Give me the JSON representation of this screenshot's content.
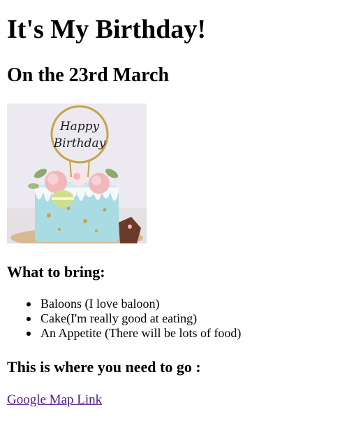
{
  "title": "It's My Birthday!",
  "date_heading": "On the 23rd March",
  "image": {
    "label": "birthday-cake-photo",
    "topper_text": "Happy Birthday",
    "colors": {
      "background": "#eceaf0",
      "cake_blue": "#a9dbe3",
      "gold": "#c8a24a",
      "pink": "#f0b7bd",
      "macaron_green": "#cfe08a"
    }
  },
  "bring": {
    "heading": "What to bring:",
    "items": [
      "Baloons (I love baloon)",
      "Cake(I'm really good at eating)",
      "An Appetite (There will be lots of food)"
    ]
  },
  "location": {
    "heading": "This is where you need to go :",
    "link_text": "Google Map Link"
  },
  "colors": {
    "link": "#551a8b",
    "text": "#000000"
  }
}
